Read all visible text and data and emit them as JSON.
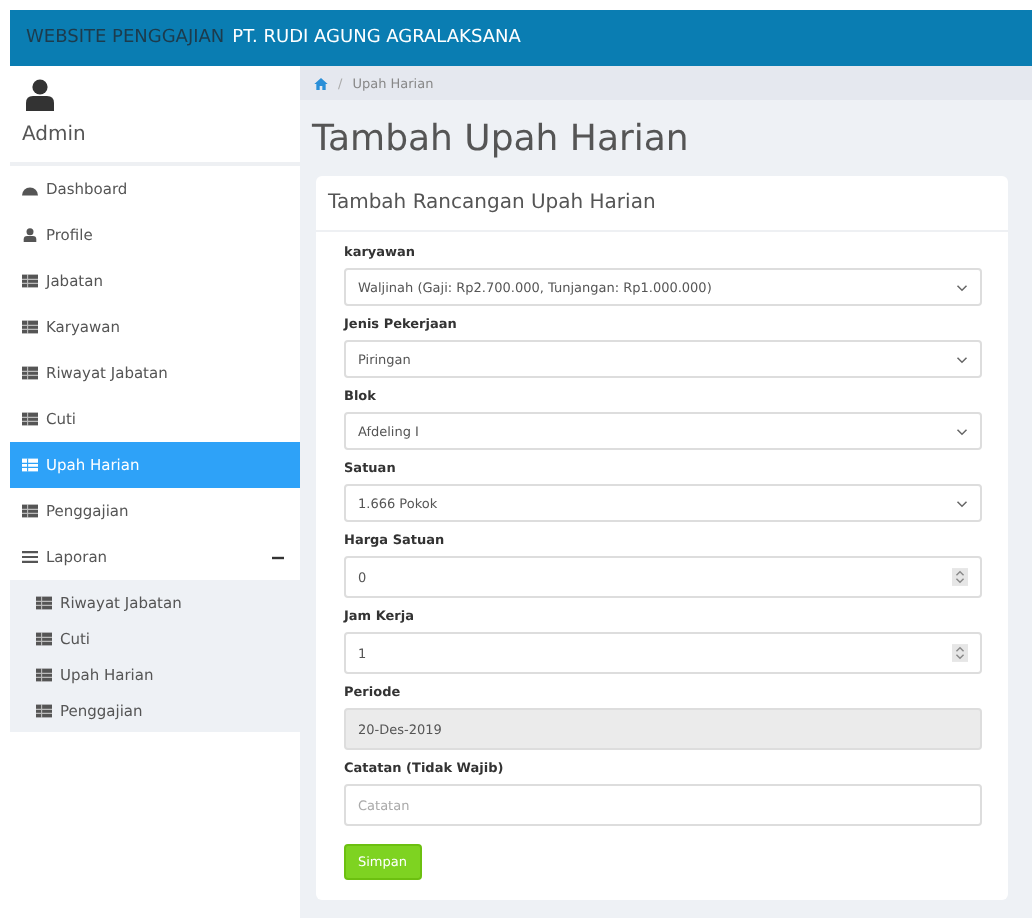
{
  "header": {
    "title": "WEBSITE PENGGAJIAN",
    "company": "PT. RUDI AGUNG AGRALAKSANA"
  },
  "user": {
    "name": "Admin"
  },
  "sidebar": {
    "items": [
      {
        "label": "Dashboard",
        "kind": "gauge",
        "selected": false
      },
      {
        "label": "Profile",
        "kind": "user",
        "selected": false
      },
      {
        "label": "Jabatan",
        "kind": "table",
        "selected": false
      },
      {
        "label": "Karyawan",
        "kind": "table",
        "selected": false
      },
      {
        "label": "Riwayat Jabatan",
        "kind": "table",
        "selected": false
      },
      {
        "label": "Cuti",
        "kind": "table",
        "selected": false
      },
      {
        "label": "Upah Harian",
        "kind": "table",
        "selected": true
      },
      {
        "label": "Penggajian",
        "kind": "table",
        "selected": false
      },
      {
        "label": "Laporan",
        "kind": "list",
        "selected": false,
        "expanded": true,
        "children": [
          {
            "label": "Riwayat Jabatan",
            "kind": "table",
            "selected": false
          },
          {
            "label": "Cuti",
            "kind": "table",
            "selected": false
          },
          {
            "label": "Upah Harian",
            "kind": "table",
            "selected": false
          },
          {
            "label": "Penggajian",
            "kind": "table",
            "selected": false
          }
        ]
      }
    ]
  },
  "breadcrumb": {
    "separator": "/",
    "current": "Upah Harian"
  },
  "page_title": "Tambah Upah Harian",
  "panel": {
    "title": "Tambah Rancangan Upah Harian",
    "fields": [
      {
        "label": "karyawan",
        "kind": "select",
        "value": "Waljinah (Gaji: Rp2.700.000, Tunjangan: Rp1.000.000)"
      },
      {
        "label": "Jenis Pekerjaan",
        "kind": "select",
        "value": "Piringan"
      },
      {
        "label": "Blok",
        "kind": "select",
        "value": "Afdeling I"
      },
      {
        "label": "Satuan",
        "kind": "select",
        "value": "1.666 Pokok"
      },
      {
        "label": "Harga Satuan",
        "kind": "number",
        "value": "0"
      },
      {
        "label": "Jam Kerja",
        "kind": "number",
        "value": "1"
      },
      {
        "label": "Periode",
        "kind": "readonly",
        "value": "20-Des-2019"
      },
      {
        "label": "Catatan (Tidak Wajib)",
        "kind": "text",
        "placeholder": "Catatan"
      }
    ],
    "submit": "Simpan"
  }
}
